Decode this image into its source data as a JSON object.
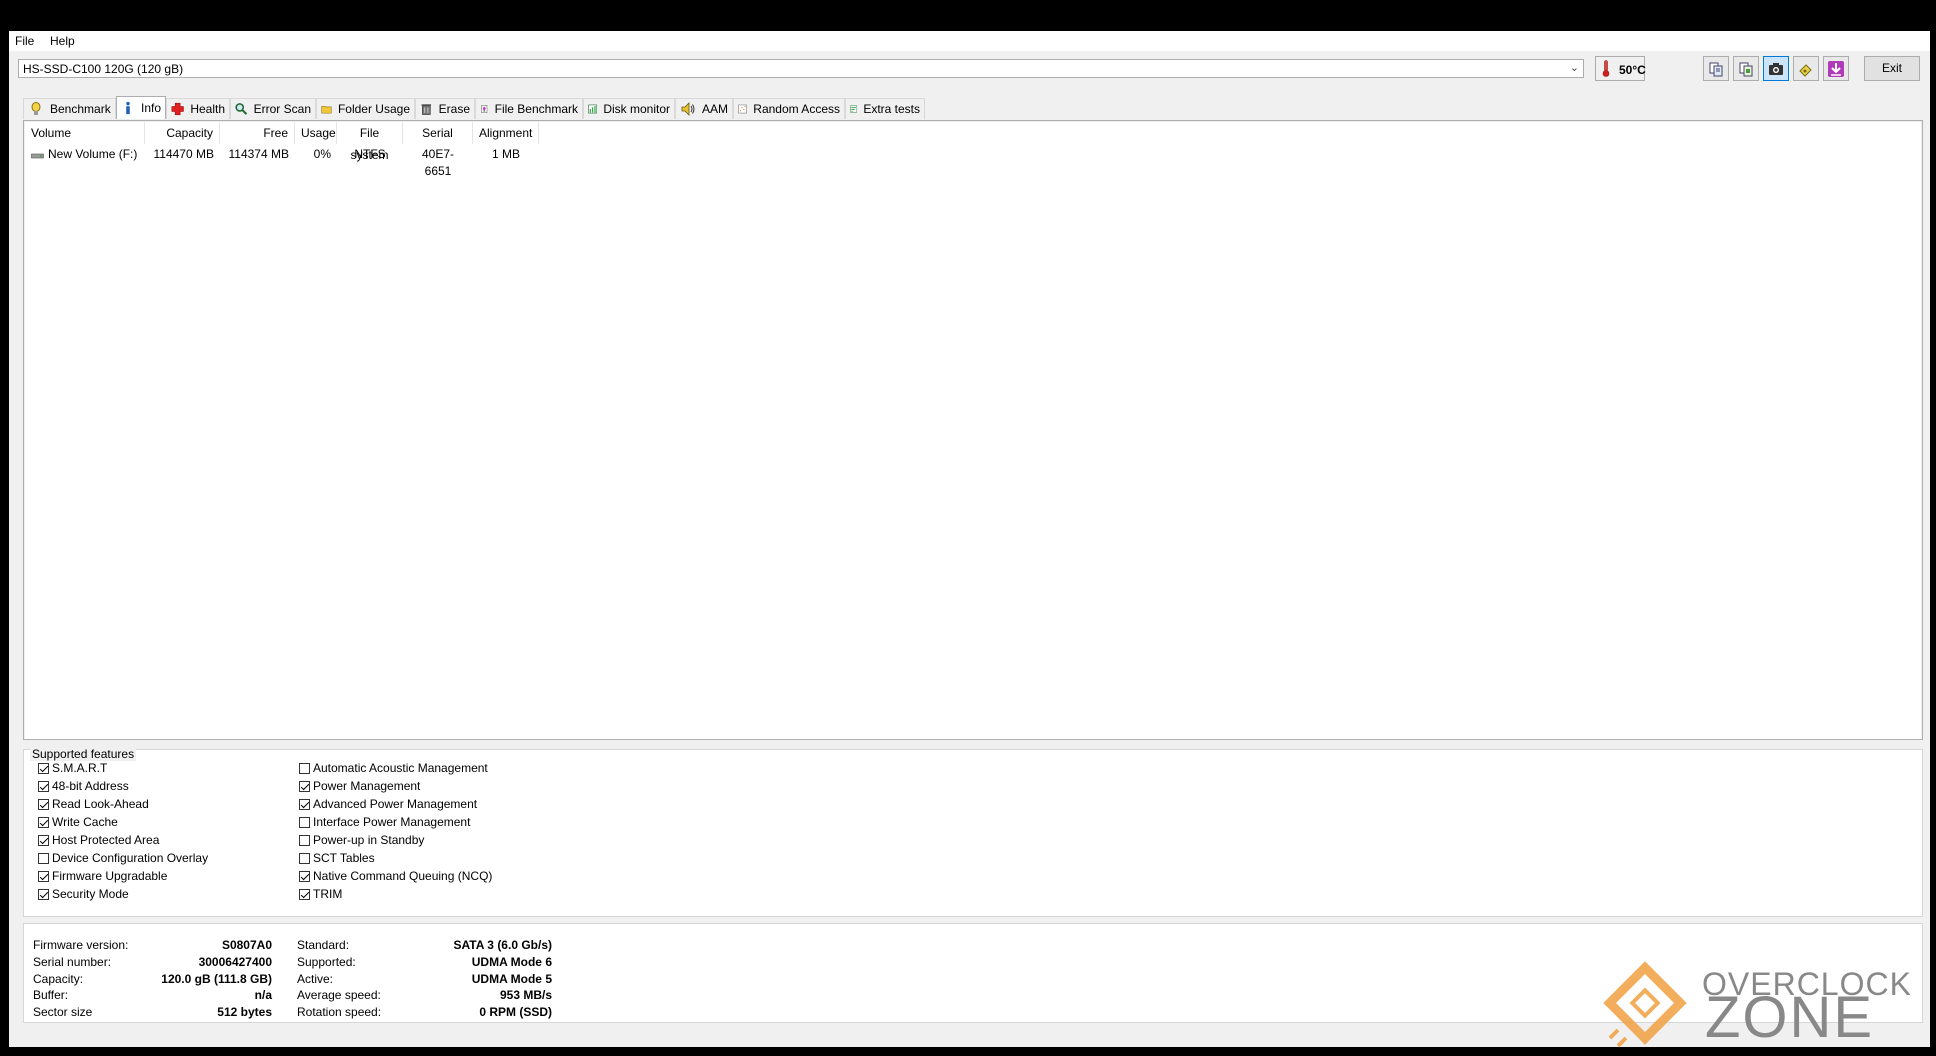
{
  "menu": {
    "file": "File",
    "help": "Help"
  },
  "toolbar": {
    "drive": "HS-SSD-C100 120G (120 gB)",
    "temperature": "50°C",
    "exit": "Exit",
    "buttons": [
      "copy-text-icon",
      "copy-info-icon",
      "screenshot-icon",
      "save-icon",
      "download-icon"
    ]
  },
  "tabs": [
    {
      "label": "Benchmark",
      "icon": "benchmark-icon"
    },
    {
      "label": "Info",
      "icon": "info-icon",
      "active": true
    },
    {
      "label": "Health",
      "icon": "health-icon"
    },
    {
      "label": "Error Scan",
      "icon": "error-scan-icon"
    },
    {
      "label": "Folder Usage",
      "icon": "folder-icon"
    },
    {
      "label": "Erase",
      "icon": "erase-icon"
    },
    {
      "label": "File Benchmark",
      "icon": "file-benchmark-icon"
    },
    {
      "label": "Disk monitor",
      "icon": "disk-monitor-icon"
    },
    {
      "label": "AAM",
      "icon": "speaker-icon"
    },
    {
      "label": "Random Access",
      "icon": "random-access-icon"
    },
    {
      "label": "Extra tests",
      "icon": "extra-tests-icon"
    }
  ],
  "volumes": {
    "headers": [
      "Volume",
      "Capacity",
      "Free",
      "Usage",
      "File system",
      "Serial",
      "Alignment"
    ],
    "rows": [
      [
        "New Volume (F:)",
        "114470 MB",
        "114374 MB",
        "0%",
        "NTFS",
        "40E7-6651",
        "1 MB"
      ]
    ]
  },
  "features": {
    "title": "Supported features",
    "left": [
      {
        "label": "S.M.A.R.T",
        "checked": true
      },
      {
        "label": "48-bit Address",
        "checked": true
      },
      {
        "label": "Read Look-Ahead",
        "checked": true
      },
      {
        "label": "Write Cache",
        "checked": true
      },
      {
        "label": "Host Protected Area",
        "checked": true
      },
      {
        "label": "Device Configuration Overlay",
        "checked": false
      },
      {
        "label": "Firmware Upgradable",
        "checked": true
      },
      {
        "label": "Security Mode",
        "checked": true
      }
    ],
    "right": [
      {
        "label": "Automatic Acoustic Management",
        "checked": false
      },
      {
        "label": "Power Management",
        "checked": true
      },
      {
        "label": "Advanced Power Management",
        "checked": true
      },
      {
        "label": "Interface Power Management",
        "checked": false
      },
      {
        "label": "Power-up in Standby",
        "checked": false
      },
      {
        "label": "SCT Tables",
        "checked": false
      },
      {
        "label": "Native Command Queuing (NCQ)",
        "checked": true
      },
      {
        "label": "TRIM",
        "checked": true
      }
    ]
  },
  "info": {
    "left": [
      {
        "label": "Firmware version:",
        "value": "S0807A0"
      },
      {
        "label": "Serial number:",
        "value": "30006427400"
      },
      {
        "label": "Capacity:",
        "value": "120.0 gB (111.8 GB)"
      },
      {
        "label": "Buffer:",
        "value": "n/a"
      },
      {
        "label": "Sector size",
        "value": "512 bytes"
      }
    ],
    "right": [
      {
        "label": "Standard:",
        "value": "SATA 3 (6.0 Gb/s)"
      },
      {
        "label": "Supported:",
        "value": "UDMA Mode 6"
      },
      {
        "label": "Active:",
        "value": "UDMA Mode 5"
      },
      {
        "label": "Average speed:",
        "value": "953 MB/s"
      },
      {
        "label": "Rotation speed:",
        "value": "0 RPM (SSD)"
      }
    ]
  },
  "watermark": {
    "line1": "OVERCLOCK",
    "line2": "ZONE"
  },
  "colors": {
    "accent": "#0078d7",
    "watermark": "#f0a040"
  }
}
